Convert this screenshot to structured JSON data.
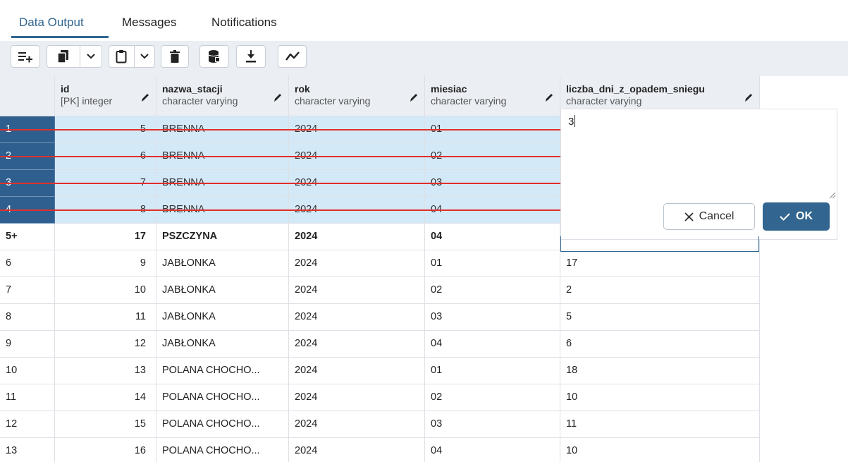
{
  "tabs": [
    {
      "label": "Data Output",
      "active": true
    },
    {
      "label": "Messages",
      "active": false
    },
    {
      "label": "Notifications",
      "active": false
    }
  ],
  "toolbar": {
    "icons": [
      "add-row-icon",
      "copy-icon",
      "chevron-down-icon",
      "paste-icon",
      "chevron-down-icon",
      "delete-icon",
      "save-data-icon",
      "download-icon",
      "graph-icon"
    ]
  },
  "columns": [
    {
      "name": "id",
      "type": "[PK] integer"
    },
    {
      "name": "nazwa_stacji",
      "type": "character varying"
    },
    {
      "name": "rok",
      "type": "character varying"
    },
    {
      "name": "miesiac",
      "type": "character varying"
    },
    {
      "name": "liczba_dni_z_opadem_sniegu",
      "type": "character varying"
    }
  ],
  "rows": [
    {
      "num": "1",
      "id": "5",
      "station": "BRENNA",
      "year": "2024",
      "month": "01",
      "days": "",
      "state": "deleted"
    },
    {
      "num": "2",
      "id": "6",
      "station": "BRENNA",
      "year": "2024",
      "month": "02",
      "days": "",
      "state": "deleted"
    },
    {
      "num": "3",
      "id": "7",
      "station": "BRENNA",
      "year": "2024",
      "month": "03",
      "days": "",
      "state": "deleted"
    },
    {
      "num": "4",
      "id": "8",
      "station": "BRENNA",
      "year": "2024",
      "month": "04",
      "days": "",
      "state": "deleted"
    },
    {
      "num": "5+",
      "id": "17",
      "station": "PSZCZYNA",
      "year": "2024",
      "month": "04",
      "days": "",
      "state": "new"
    },
    {
      "num": "6",
      "id": "9",
      "station": "JABŁONKA",
      "year": "2024",
      "month": "01",
      "days": "17",
      "state": "normal"
    },
    {
      "num": "7",
      "id": "10",
      "station": "JABŁONKA",
      "year": "2024",
      "month": "02",
      "days": "2",
      "state": "normal"
    },
    {
      "num": "8",
      "id": "11",
      "station": "JABŁONKA",
      "year": "2024",
      "month": "03",
      "days": "5",
      "state": "normal"
    },
    {
      "num": "9",
      "id": "12",
      "station": "JABŁONKA",
      "year": "2024",
      "month": "04",
      "days": "6",
      "state": "normal"
    },
    {
      "num": "10",
      "id": "13",
      "station": "POLANA CHOCHO...",
      "year": "2024",
      "month": "01",
      "days": "18",
      "state": "normal"
    },
    {
      "num": "11",
      "id": "14",
      "station": "POLANA CHOCHO...",
      "year": "2024",
      "month": "02",
      "days": "10",
      "state": "normal"
    },
    {
      "num": "12",
      "id": "15",
      "station": "POLANA CHOCHO...",
      "year": "2024",
      "month": "03",
      "days": "11",
      "state": "normal"
    },
    {
      "num": "13",
      "id": "16",
      "station": "POLANA CHOCHO...",
      "year": "2024",
      "month": "04",
      "days": "10",
      "state": "normal"
    }
  ],
  "editor": {
    "value": "3",
    "cancel_label": "Cancel",
    "ok_label": "OK"
  },
  "colors": {
    "accent": "#326690",
    "deleted_row_bg": "#d4e9f8",
    "deleted_rownum_bg": "#2f5f8e",
    "strike": "#e0302a"
  }
}
